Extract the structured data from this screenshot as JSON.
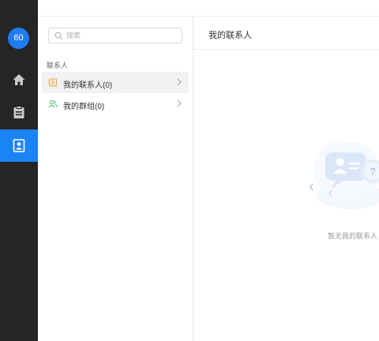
{
  "rail": {
    "avatar_text": "60",
    "items": [
      {
        "icon": "home-icon",
        "active": false
      },
      {
        "icon": "notebook-icon",
        "active": false
      },
      {
        "icon": "contacts-icon",
        "active": true
      }
    ],
    "accent_color": "#1b84f5",
    "background_color": "#252525"
  },
  "search": {
    "placeholder": "搜索",
    "value": ""
  },
  "contacts": {
    "section_label": "联系人",
    "items": [
      {
        "label": "我的联系人(0)",
        "icon": "contact-card-icon",
        "icon_color": "#f0a73a",
        "selected": true
      },
      {
        "label": "我的群组(0)",
        "icon": "group-icon",
        "icon_color": "#4cb86b",
        "selected": false
      }
    ]
  },
  "detail": {
    "title": "我的联系人",
    "empty_message": "暂无我的联系人",
    "illustration": "empty-contacts-illustration"
  }
}
